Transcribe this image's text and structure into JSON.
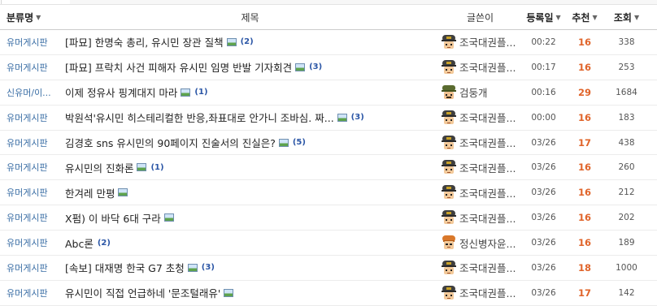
{
  "header": {
    "category": "분류명",
    "title": "제목",
    "author": "글쓴이",
    "date": "등록일",
    "recommend": "추천",
    "views": "조회"
  },
  "rows": [
    {
      "category": "유머게시판",
      "title": "[파묘] 한명숙 총리, 유시민 장관 질책",
      "has_image": true,
      "comments": "(2)",
      "avatar": "helmet-avatar",
      "author": "조국대권플...",
      "date": "00:22",
      "recommend": "16",
      "views": "338"
    },
    {
      "category": "유머게시판",
      "title": "[파묘] 프락치 사건 피해자 유시민 임명 반발 기자회견",
      "has_image": true,
      "comments": "(3)",
      "avatar": "helmet-avatar",
      "author": "조국대권플...",
      "date": "00:17",
      "recommend": "16",
      "views": "253"
    },
    {
      "category": "신유머/이...",
      "title": "이제 정유사 핑계대지 마라",
      "has_image": true,
      "comments": "(1)",
      "avatar": "soldier-avatar",
      "author": "검둥개",
      "date": "00:16",
      "recommend": "29",
      "views": "1684"
    },
    {
      "category": "유머게시판",
      "title": "박원석'유시민 히스테리컬한 반응,좌표대로 안가니 조바심. 짜...",
      "has_image": true,
      "comments": "(3)",
      "avatar": "helmet-avatar",
      "author": "조국대권플...",
      "date": "00:00",
      "recommend": "16",
      "views": "183"
    },
    {
      "category": "유머게시판",
      "title": "김경호 sns 유시민의 90페이지 진술서의 진실은?",
      "has_image": true,
      "comments": "(5)",
      "avatar": "helmet-avatar",
      "author": "조국대권플...",
      "date": "03/26",
      "recommend": "17",
      "views": "438"
    },
    {
      "category": "유머게시판",
      "title": "유시민의 진화론",
      "has_image": true,
      "comments": "(1)",
      "avatar": "helmet-avatar",
      "author": "조국대권플...",
      "date": "03/26",
      "recommend": "16",
      "views": "260"
    },
    {
      "category": "유머게시판",
      "title": "한겨레 만평",
      "has_image": true,
      "comments": "",
      "avatar": "helmet-avatar",
      "author": "조국대권플...",
      "date": "03/26",
      "recommend": "16",
      "views": "212"
    },
    {
      "category": "유머게시판",
      "title": "X펌) 이 바닥 6대 구라",
      "has_image": true,
      "comments": "",
      "avatar": "helmet-avatar",
      "author": "조국대권플...",
      "date": "03/26",
      "recommend": "16",
      "views": "202"
    },
    {
      "category": "유머게시판",
      "title": "Abc론",
      "has_image": false,
      "comments": "(2)",
      "avatar": "orange-hair-avatar",
      "author": "정신병자윤...",
      "date": "03/26",
      "recommend": "16",
      "views": "189"
    },
    {
      "category": "유머게시판",
      "title": "[속보] 대재명 한국 G7 초청",
      "has_image": true,
      "comments": "(3)",
      "avatar": "helmet-avatar",
      "author": "조국대권플...",
      "date": "03/26",
      "recommend": "18",
      "views": "1000"
    },
    {
      "category": "유머게시판",
      "title": "유시민이 직접 언급하네 '문조털래유'",
      "has_image": true,
      "comments": "",
      "avatar": "helmet-avatar",
      "author": "조국대권플...",
      "date": "03/26",
      "recommend": "17",
      "views": "142"
    }
  ],
  "colors": {
    "category_link": "#3a6ea5",
    "comment_count": "#2b56a6",
    "recommend": "#e0642a",
    "helmet": "#3f3f3f",
    "soldier": "#5a6b2f",
    "orange_hair": "#d9782a"
  }
}
